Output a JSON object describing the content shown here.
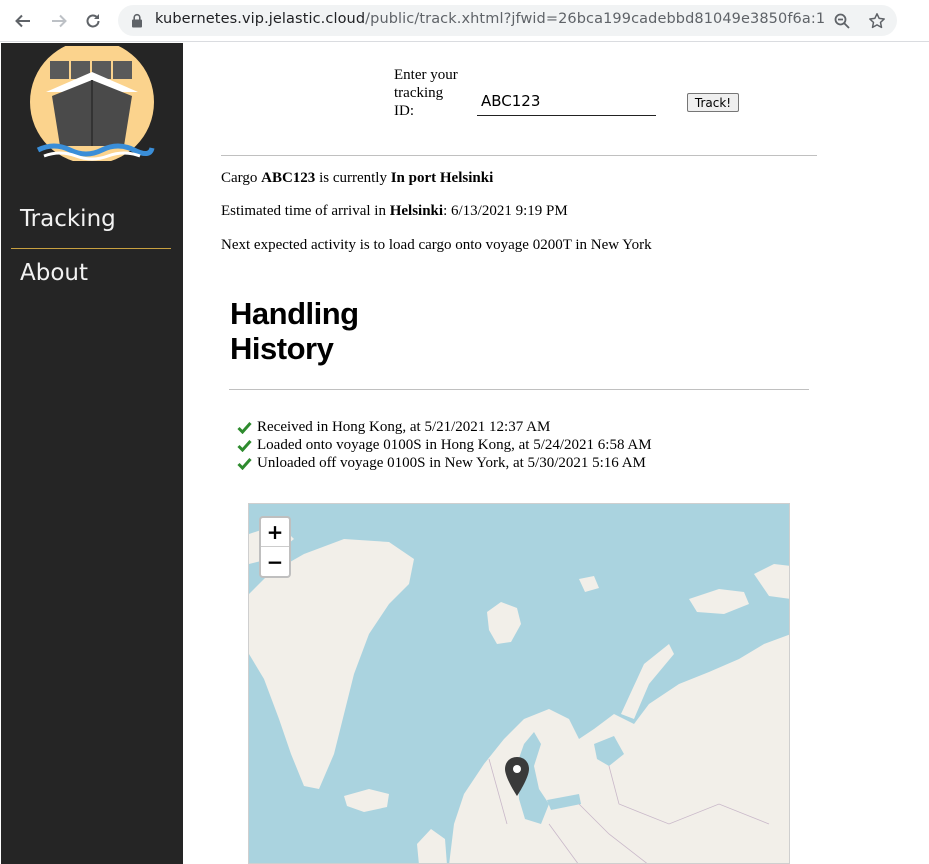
{
  "browser": {
    "url_host": "kubernetes.vip.jelastic.cloud",
    "url_path": "/public/track.xhtml?jfwid=26bca199cadebbd81049e3850f6a:1"
  },
  "sidebar": {
    "items": [
      {
        "label": "Tracking"
      },
      {
        "label": "About"
      }
    ]
  },
  "tracking_form": {
    "label": "Enter your tracking ID:",
    "input_value": "ABC123",
    "button_label": "Track!"
  },
  "status": {
    "line1_prefix": "Cargo ",
    "cargo_id": "ABC123",
    "line1_mid": " is currently ",
    "current_status": "In port Helsinki",
    "line2_prefix": "Estimated time of arrival in ",
    "destination": "Helsinki",
    "line2_suffix": ": 6/13/2021 9:19 PM",
    "line3": "Next expected activity is to load cargo onto voyage 0200T in New York"
  },
  "history": {
    "title": "Handling History",
    "events": [
      "Received in Hong Kong, at 5/21/2021 12:37 AM",
      "Loaded onto voyage 0100S in Hong Kong, at 5/24/2021 6:58 AM",
      "Unloaded off voyage 0100S in New York, at 5/30/2021 5:16 AM"
    ]
  },
  "map": {
    "zoom_in": "+",
    "zoom_out": "−",
    "water_color": "#aad3df",
    "land_color": "#f2efe9"
  }
}
